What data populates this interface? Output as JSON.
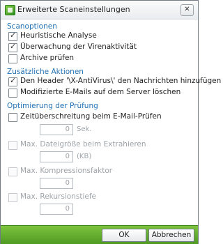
{
  "window": {
    "title": "Erweiterte Scaneinstellungen",
    "close_glyph": "✕"
  },
  "sections": {
    "scan": "Scanoptionen",
    "actions": "Zusätzliche Aktionen",
    "optimize": "Optimierung der Prüfung"
  },
  "options": {
    "heuristic": {
      "label": "Heuristische Analyse",
      "checked": true
    },
    "virus_activity": {
      "label": "Überwachung der Virenaktivität",
      "checked": true
    },
    "archives": {
      "label": "Archive prüfen",
      "checked": false
    },
    "header": {
      "label": "Den Header '\\X-AntiVirus\\' den Nachrichten hinzufügen",
      "checked": true
    },
    "modified_mail": {
      "label": "Modifizierte E-Mails auf dem Server löschen",
      "checked": false
    },
    "timeout": {
      "label": "Zeitüberschreitung beim E-Mail-Prüfen",
      "checked": false,
      "value": "0",
      "unit": "Sek."
    },
    "max_file_size": {
      "label": "Max. Dateigröße beim Extrahieren",
      "checked": false,
      "value": "0",
      "unit": "(KB)"
    },
    "max_compression": {
      "label": "Max. Kompressionsfaktor",
      "checked": false,
      "value": "0"
    },
    "max_recursion": {
      "label": "Max. Rekursionstiefe",
      "checked": false,
      "value": "0"
    }
  },
  "check_mark": "✓",
  "buttons": {
    "ok": "OK",
    "cancel": "Abbrechen"
  },
  "icons": {
    "app": "app-icon",
    "close": "close-icon",
    "check": "checkmark-icon"
  },
  "colors": {
    "section_heading": "#1f6fb2",
    "footer_green": "#5fa92b"
  }
}
